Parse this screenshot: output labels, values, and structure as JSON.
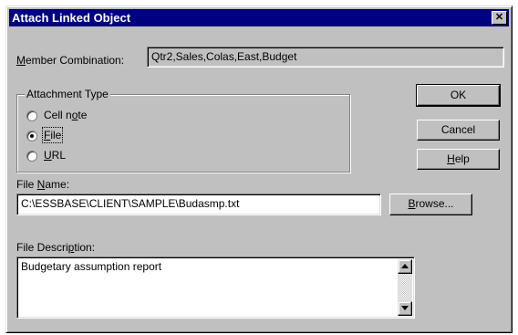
{
  "dialog": {
    "title": "Attach Linked Object",
    "close_icon": "close-icon"
  },
  "member_combination": {
    "label_pre": "",
    "label_accel": "M",
    "label_post": "ember Combination:",
    "value": "Qtr2,Sales,Colas,East,Budget"
  },
  "attachment_type": {
    "title": "Attachment Type",
    "options": [
      {
        "pre": "Cell n",
        "accel": "o",
        "post": "te",
        "selected": false
      },
      {
        "pre": "",
        "accel": "F",
        "post": "ile",
        "selected": true
      },
      {
        "pre": "",
        "accel": "U",
        "post": "RL",
        "selected": false
      }
    ]
  },
  "file_name": {
    "label_pre": "File ",
    "label_accel": "N",
    "label_post": "ame:",
    "value": "C:\\ESSBASE\\CLIENT\\SAMPLE\\Budasmp.txt"
  },
  "browse_button": {
    "pre": "",
    "accel": "B",
    "post": "rowse..."
  },
  "file_description": {
    "label_pre": "File Descri",
    "label_accel": "p",
    "label_post": "tion:",
    "value": "Budgetary assumption report"
  },
  "buttons": {
    "ok": "OK",
    "cancel": "Cancel",
    "help_pre": "",
    "help_accel": "H",
    "help_post": "elp"
  }
}
